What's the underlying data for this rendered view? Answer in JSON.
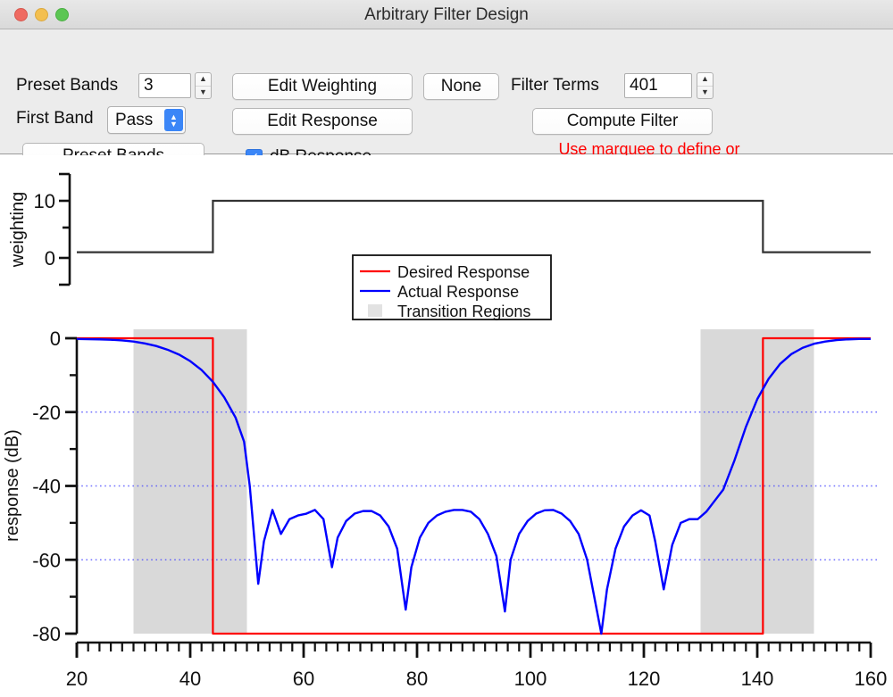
{
  "window": {
    "title": "Arbitrary Filter Design",
    "traffic_lights": [
      "close",
      "minimize",
      "zoom"
    ]
  },
  "controls": {
    "preset_bands_label": "Preset Bands",
    "preset_bands_value": "3",
    "first_band_label": "First Band",
    "first_band_value": "Pass",
    "preset_bands_button": "Preset Bands",
    "edit_weighting_button": "Edit Weighting",
    "edit_response_button": "Edit Response",
    "none_button": "None",
    "filter_terms_label": "Filter Terms",
    "filter_terms_value": "401",
    "compute_filter_button": "Compute Filter",
    "db_response_label": "dB Response",
    "db_response_checked": true,
    "check_glyph": "✓",
    "hint_text": "Use marquee to define or\nremove a transition region.",
    "hint_color": "#ff0000",
    "accent_color": "#3b86f7"
  },
  "chart_data": [
    {
      "type": "line",
      "name": "weighting",
      "title": "",
      "xlabel": "",
      "ylabel": "weighting",
      "xlim": [
        20,
        160
      ],
      "ylim": [
        -5,
        15
      ],
      "yticks": [
        0,
        10
      ],
      "ytick_labels": [
        "0",
        "10"
      ],
      "grid": false,
      "series": [
        {
          "name": "weighting",
          "color": "#333333",
          "x": [
            20,
            44,
            44,
            141,
            141,
            160
          ],
          "values": [
            1,
            1,
            10,
            10,
            1,
            1
          ]
        }
      ]
    },
    {
      "type": "line",
      "name": "response",
      "title": "",
      "xlabel": "",
      "ylabel": "response (dB)",
      "xlim": [
        20,
        160
      ],
      "ylim": [
        -80,
        2
      ],
      "xticks": [
        20,
        40,
        60,
        80,
        100,
        120,
        140,
        160
      ],
      "xtick_labels": [
        "20",
        "40",
        "60",
        "80",
        "100",
        "120",
        "140",
        "160"
      ],
      "yticks": [
        0,
        -20,
        -40,
        -60,
        -80
      ],
      "ytick_labels": [
        "0",
        "-20",
        "-40",
        "-60",
        "-80"
      ],
      "gridlines_y": [
        -20,
        -40,
        -60
      ],
      "grid": true,
      "grid_color": "#4040ff",
      "grid_style": "dotted",
      "transition_regions": [
        {
          "start": 30,
          "end": 50
        },
        {
          "start": 130,
          "end": 150
        }
      ],
      "transition_color": "#d9d9d9",
      "series": [
        {
          "name": "Desired Response",
          "color": "#ff0000",
          "x": [
            20,
            44,
            44,
            141,
            141,
            160
          ],
          "values": [
            0,
            0,
            -80,
            -80,
            0,
            0
          ]
        },
        {
          "name": "Actual Response",
          "color": "#0000ff",
          "x": [
            20,
            22,
            24,
            26,
            28,
            30,
            32,
            34,
            36,
            38,
            40,
            42,
            44,
            46,
            48,
            49.5,
            50.5,
            52,
            53,
            54.5,
            56,
            57.5,
            59,
            60.5,
            62,
            63.5,
            65,
            66,
            67.5,
            69,
            70.5,
            72,
            73.5,
            75,
            76.5,
            78,
            79,
            80.5,
            82,
            83.5,
            85,
            86.5,
            88,
            89.5,
            91,
            92.5,
            94,
            95.5,
            96.5,
            98,
            99.5,
            101,
            102.5,
            104,
            105.5,
            107,
            108.5,
            110,
            111.5,
            112.5,
            113.5,
            115,
            116.5,
            118,
            119.5,
            121,
            122,
            123.5,
            125,
            126.5,
            128,
            129.5,
            131,
            132.5,
            134,
            136,
            138,
            140,
            142,
            144,
            146,
            148,
            150,
            152,
            154,
            156,
            158,
            160
          ],
          "values": [
            -0.2,
            -0.25,
            -0.3,
            -0.4,
            -0.6,
            -0.9,
            -1.4,
            -2.1,
            -3.1,
            -4.4,
            -6.2,
            -8.6,
            -11.8,
            -16,
            -21.5,
            -28,
            -40,
            -66.5,
            -55,
            -46.5,
            -53,
            -49,
            -48,
            -47.5,
            -46.5,
            -49,
            -62,
            -54,
            -49.5,
            -47.5,
            -46.8,
            -46.8,
            -48,
            -51,
            -57,
            -73.5,
            -62,
            -54,
            -50,
            -48,
            -47,
            -46.5,
            -46.5,
            -47,
            -49,
            -53,
            -59,
            -74,
            -60,
            -53,
            -49.5,
            -47.5,
            -46.6,
            -46.5,
            -47.5,
            -49.5,
            -53,
            -60,
            -72,
            -80,
            -68,
            -57,
            -51,
            -48,
            -46.6,
            -48,
            -55,
            -68,
            -56,
            -50,
            -49,
            -49,
            -47,
            -44,
            -41,
            -33,
            -24,
            -16.5,
            -11,
            -7,
            -4.3,
            -2.6,
            -1.5,
            -0.9,
            -0.5,
            -0.3,
            -0.2,
            -0.2
          ]
        }
      ],
      "legend": {
        "position": "upper-center",
        "entries": [
          {
            "label": "Desired Response",
            "type": "line",
            "color": "#ff0000"
          },
          {
            "label": "Actual Response",
            "type": "line",
            "color": "#0000ff"
          },
          {
            "label": "Transition Regions",
            "type": "patch",
            "color": "#e2e2e2"
          }
        ]
      }
    }
  ]
}
